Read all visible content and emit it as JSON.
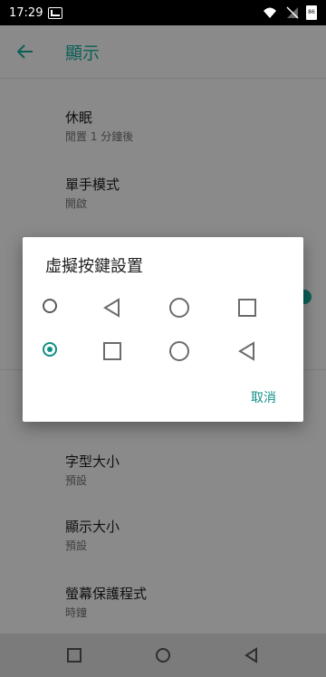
{
  "status_bar": {
    "time": "17:29",
    "icons": [
      "notification-icon",
      "wifi-icon",
      "no-signal-icon",
      "battery-icon"
    ],
    "battery_label": "86"
  },
  "app_bar": {
    "title": "顯示",
    "back_icon": "arrow-left-icon"
  },
  "settings": {
    "items": [
      {
        "title": "休眠",
        "summary": "閒置 1 分鐘後"
      },
      {
        "title": "單手模式",
        "summary": "開啟"
      },
      {
        "title": "字型大小",
        "summary": "預設"
      },
      {
        "title": "顯示大小",
        "summary": "預設"
      },
      {
        "title": "螢幕保護程式",
        "summary": "時鐘"
      }
    ]
  },
  "dialog": {
    "title": "虛擬按鍵設置",
    "options": [
      {
        "selected": false,
        "icons": [
          "triangle-left-icon",
          "circle-icon",
          "square-icon"
        ]
      },
      {
        "selected": true,
        "icons": [
          "square-icon",
          "circle-icon",
          "triangle-left-icon"
        ]
      }
    ],
    "cancel_label": "取消"
  },
  "bottom_nav": {
    "icons": [
      "square-icon",
      "circle-icon",
      "triangle-left-icon"
    ]
  },
  "colors": {
    "accent": "#0f8f86",
    "title_teal": "#0b5f58",
    "status_bar": "#000000",
    "dimmed_background": "#8a8a8a"
  }
}
